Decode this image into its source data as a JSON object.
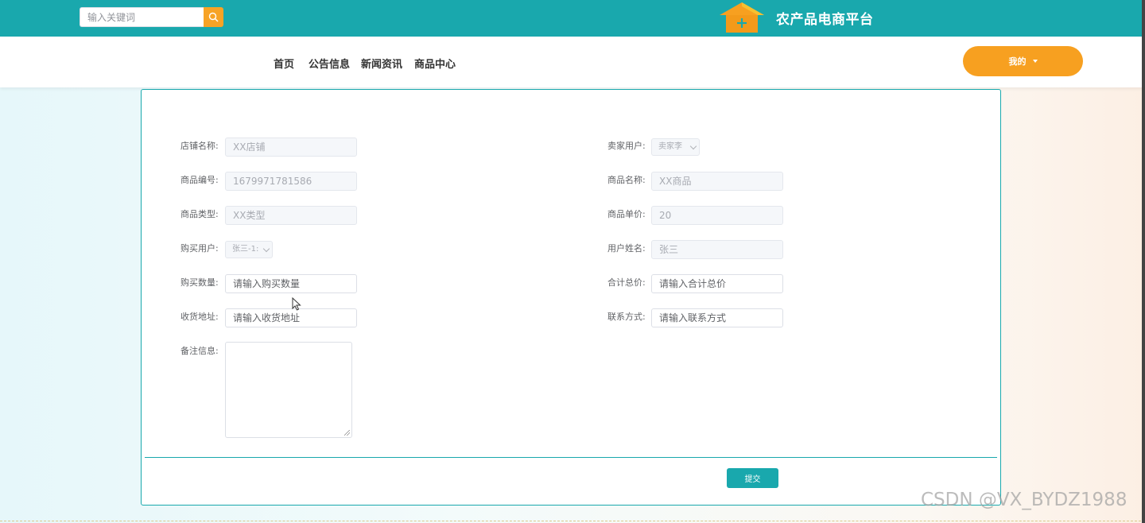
{
  "header": {
    "search_placeholder": "输入关键词",
    "site_title": "农产品电商平台"
  },
  "nav": {
    "items": [
      "首页",
      "公告信息",
      "新闻资讯",
      "商品中心"
    ],
    "me_label": "我的"
  },
  "form": {
    "shop_name": {
      "label": "店铺名称:",
      "value": "XX店铺"
    },
    "seller_user": {
      "label": "卖家用户:",
      "value": "卖家李"
    },
    "goods_no": {
      "label": "商品编号:",
      "value": "1679971781586"
    },
    "goods_name": {
      "label": "商品名称:",
      "value": "XX商品"
    },
    "goods_type": {
      "label": "商品类型:",
      "value": "XX类型"
    },
    "unit_price": {
      "label": "商品单价:",
      "value": "20"
    },
    "buyer_user": {
      "label": "购买用户:",
      "value": "张三-1:"
    },
    "user_name": {
      "label": "用户姓名:",
      "value": "张三"
    },
    "quantity": {
      "label": "购买数量:",
      "placeholder": "请输入购买数量"
    },
    "total_price": {
      "label": "合计总价:",
      "placeholder": "请输入合计总价"
    },
    "address": {
      "label": "收货地址:",
      "placeholder": "请输入收货地址"
    },
    "contact": {
      "label": "联系方式:",
      "placeholder": "请输入联系方式"
    },
    "remark": {
      "label": "备注信息:"
    },
    "submit_label": "提交"
  },
  "watermark": "CSDN @VX_BYDZ1988",
  "colors": {
    "primary": "#19a8ad",
    "accent": "#f7a020"
  }
}
